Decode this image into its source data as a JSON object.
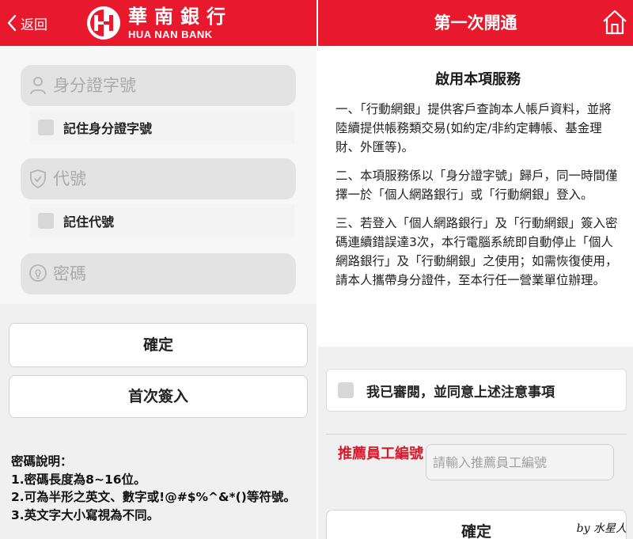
{
  "left": {
    "header": {
      "back_label": "返回",
      "logo_cn": "華南銀行",
      "logo_en": "HUA NAN BANK",
      "brand_color": "#e8192c"
    },
    "form": {
      "id_field": {
        "placeholder": "身分證字號",
        "icon": "user-icon"
      },
      "remember_id": {
        "label": "記住身分證字號",
        "checked": false
      },
      "code_field": {
        "placeholder": "代號",
        "icon": "shield-icon"
      },
      "remember_code": {
        "label": "記住代號",
        "checked": false
      },
      "password_field": {
        "placeholder": "密碼",
        "icon": "lightbulb-icon"
      }
    },
    "buttons": {
      "confirm": "確定",
      "first_login": "首次簽入"
    },
    "notes": {
      "title": "密碼說明：",
      "lines": [
        "1.密碼長度為8~16位。",
        "2.可為半形之英文、數字或!@#$%^&*()等符號。",
        "3.英文字大小寫視為不同。"
      ]
    }
  },
  "right": {
    "header": {
      "title": "第一次開通",
      "home_icon": "home-icon"
    },
    "terms": {
      "title": "啟用本項服務",
      "paragraphs": [
        "一、「行動網銀」提供客戶查詢本人帳戶資料，並將陸續提供帳務類交易(如約定/非約定轉帳、基金理財、外匯等)。",
        "二、本項服務係以「身分證字號」歸戶，同一時間僅擇一於「個人網路銀行」或「行動網銀」登入。",
        "三、若登入「個人網路銀行」及「行動網銀」簽入密碼連續錯誤達3次，本行電腦系統即自動停止「個人網路銀行」及「行動網銀」之使用；如需恢復使用，請本人攜帶身分證件，至本行任一營業單位辦理。"
      ]
    },
    "agree": {
      "label": "我已審閱，並同意上述注意事項",
      "checked": false
    },
    "referral": {
      "label": "推薦員工編號",
      "placeholder": "請輸入推薦員工編號"
    },
    "buttons": {
      "confirm": "確定"
    },
    "watermark": "by 水星人"
  }
}
